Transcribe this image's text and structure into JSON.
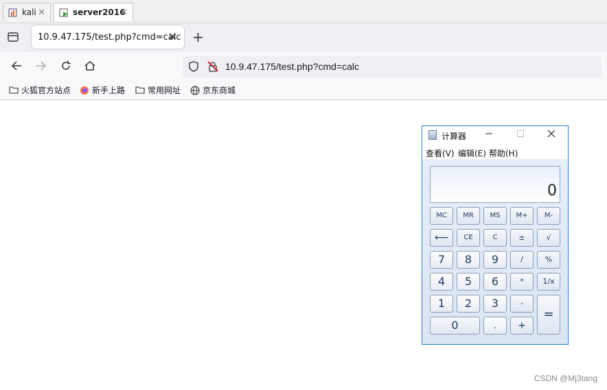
{
  "vm_tabs": [
    {
      "label": "kali",
      "active": false
    },
    {
      "label": "server2016",
      "active": true
    }
  ],
  "browser": {
    "tab_title": "10.9.47.175/test.php?cmd=calc",
    "url": "10.9.47.175/test.php?cmd=calc",
    "bookmarks": [
      "火狐官方站点",
      "新手上路",
      "常用网址",
      "京东商城"
    ]
  },
  "calculator": {
    "title": "计算器",
    "menu": [
      "查看(V)",
      "编辑(E)",
      "帮助(H)"
    ],
    "display": "0",
    "keys": {
      "mc": "MC",
      "mr": "MR",
      "ms": "MS",
      "mplus": "M+",
      "mminus": "M-",
      "back": "⟵",
      "ce": "CE",
      "c": "C",
      "plusminus": "±",
      "sqrt": "√",
      "k7": "7",
      "k8": "8",
      "k9": "9",
      "div": "/",
      "pct": "%",
      "k4": "4",
      "k5": "5",
      "k6": "6",
      "mul": "*",
      "recip": "1/x",
      "k1": "1",
      "k2": "2",
      "k3": "3",
      "minus": "-",
      "eq": "=",
      "k0": "0",
      "dot": ".",
      "plus": "+"
    }
  },
  "watermark": "CSDN @Mj3tang"
}
